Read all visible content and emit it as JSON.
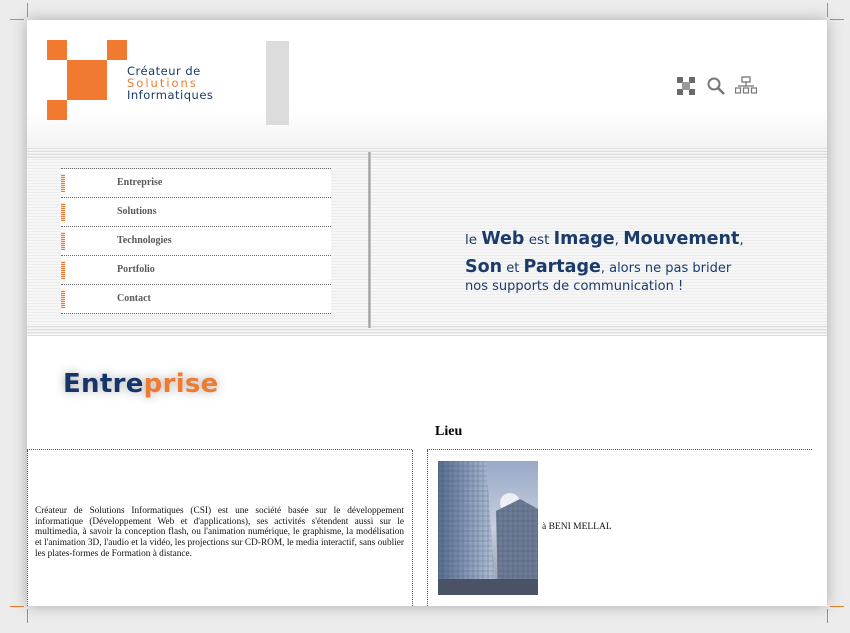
{
  "logo": {
    "line1": "Créateur de",
    "line2": "Solutions",
    "line3": "Informatiques"
  },
  "header_icons": [
    "network-icon",
    "search-icon",
    "sitemap-icon"
  ],
  "menu": [
    "Entreprise",
    "Solutions",
    "Technologies",
    "Portfolio",
    "Contact"
  ],
  "slogan": {
    "p1": "le ",
    "w1": "Web",
    "p2": " est ",
    "w2": "Image",
    "p3": ", ",
    "w3": "Mouvement",
    "p4": ",",
    "w4": "Son",
    "p5": " et ",
    "w5": "Partage",
    "p6": ", alors ne pas brider",
    "p7": "nos supports de communication !"
  },
  "section": {
    "title_a": "Entre",
    "title_b": "prise"
  },
  "lieu": {
    "title": "Lieu",
    "caption": "à BENI MELLAL"
  },
  "description": "Créateur de Solutions Informatiques (CSI) est une société basée sur le développement informatique (Développement Web et d'applications), ses activités s'étendent aussi sur le multimedia, à savoir la conception flash, ou l'animation numérique, le graphisme, la modélisation et l'animation 3D, l'audio et la vidéo, les projections sur CD-ROM, le media interactif, sans oublier les plates-formes de Formation à distance.",
  "colors": {
    "accent": "#f07a30",
    "brand": "#1b3b6b"
  }
}
